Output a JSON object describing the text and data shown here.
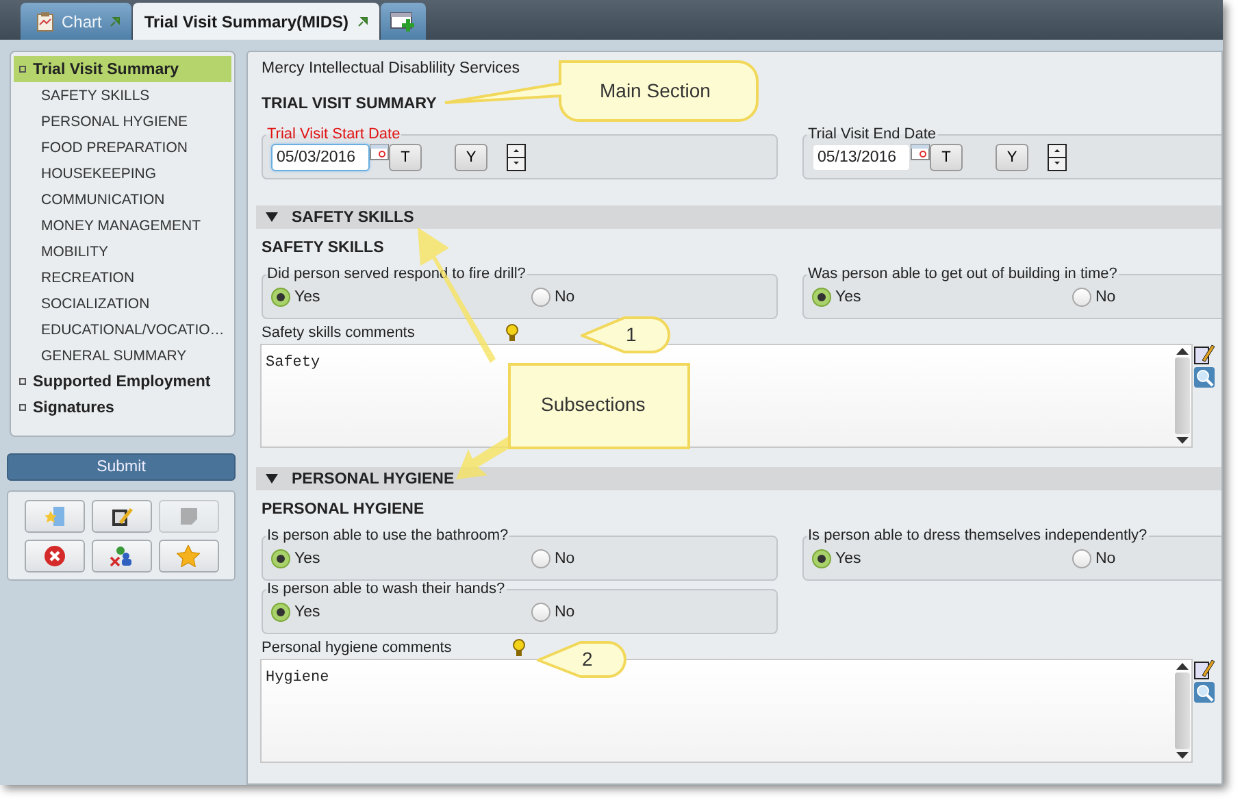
{
  "tabs": [
    {
      "label": "Chart",
      "selected": false
    },
    {
      "label": "Trial Visit Summary(MIDS)",
      "selected": true
    }
  ],
  "sidebar": {
    "tree": [
      {
        "label": "Trial Visit Summary",
        "selected": true,
        "children": [
          {
            "label": "SAFETY SKILLS",
            "selected": false
          },
          {
            "label": "PERSONAL HYGIENE",
            "selected": false
          },
          {
            "label": "FOOD PREPARATION",
            "selected": false
          },
          {
            "label": "HOUSEKEEPING",
            "selected": false
          },
          {
            "label": "COMMUNICATION",
            "selected": false
          },
          {
            "label": "MONEY MANAGEMENT",
            "selected": false
          },
          {
            "label": "MOBILITY",
            "selected": false
          },
          {
            "label": "RECREATION",
            "selected": false
          },
          {
            "label": "SOCIALIZATION",
            "selected": false
          },
          {
            "label": "EDUCATIONAL/VOCATIO…",
            "selected": false
          },
          {
            "label": "GENERAL SUMMARY",
            "selected": false
          }
        ]
      },
      {
        "label": "Supported Employment",
        "selected": false
      },
      {
        "label": "Signatures",
        "selected": false
      }
    ],
    "submit": "Submit",
    "tools": [
      {
        "kind": "open",
        "disabled": false
      },
      {
        "kind": "edit",
        "disabled": false
      },
      {
        "kind": "note",
        "disabled": true
      },
      {
        "kind": "cancel",
        "disabled": false
      },
      {
        "kind": "users",
        "disabled": false
      },
      {
        "kind": "star",
        "disabled": false
      }
    ]
  },
  "form": {
    "organization": "Mercy Intellectual Disablility Services",
    "heading": "TRIAL VISIT SUMMARY",
    "dates": [
      {
        "label": "Trial Visit Start Date",
        "required": true,
        "value": "05/03/2016",
        "focused": true,
        "buttons": [
          "T",
          "Y"
        ]
      },
      {
        "label": "Trial Visit End Date",
        "required": false,
        "value": "05/13/2016",
        "focused": false,
        "buttons": [
          "T",
          "Y"
        ]
      }
    ],
    "sections": [
      {
        "header": "SAFETY SKILLS",
        "expanded": true,
        "title": "SAFETY SKILLS",
        "questions": [
          {
            "question": "Did person served respond to fire drill?",
            "options": [
              {
                "label": "Yes",
                "selected": true
              },
              {
                "label": "No",
                "selected": false
              }
            ]
          },
          {
            "question": "Was person able to get out of building in time?",
            "options": [
              {
                "label": "Yes",
                "selected": true
              },
              {
                "label": "No",
                "selected": false
              }
            ]
          }
        ],
        "comments_label": "Safety skills comments",
        "comments": "Safety"
      },
      {
        "header": "PERSONAL HYGIENE",
        "expanded": true,
        "title": "PERSONAL HYGIENE",
        "questions": [
          {
            "question": "Is person able to use the bathroom?",
            "options": [
              {
                "label": "Yes",
                "selected": true
              },
              {
                "label": "No",
                "selected": false
              }
            ]
          },
          {
            "question": "Is person able to dress themselves independently?",
            "options": [
              {
                "label": "Yes",
                "selected": true
              },
              {
                "label": "No",
                "selected": false
              }
            ]
          },
          {
            "question": "Is person able to wash their hands?",
            "options": [
              {
                "label": "Yes",
                "selected": true
              },
              {
                "label": "No",
                "selected": false
              }
            ]
          }
        ],
        "comments_label": "Personal hygiene comments",
        "comments": "Hygiene"
      }
    ]
  },
  "callouts": [
    {
      "text": "Main Section"
    },
    {
      "text": "1"
    },
    {
      "text": "Subsections"
    },
    {
      "text": "2"
    }
  ]
}
